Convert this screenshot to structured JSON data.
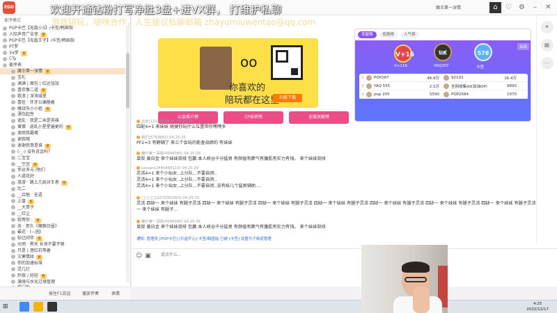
{
  "overlay": {
    "line1": "欢迎开通钻粉打写净胜3盘+进VX群，  打维护私聊",
    "line2": "游戏陪玩，啵咪合作，人生建议私聊邮箱 zhayumiuwentao@qq.com"
  },
  "topbar": {
    "logo_text": "EGO",
    "room_title": "魔王第一深情",
    "owner": "魔王第一深情",
    "window_buttons": [
      "home-icon",
      "heart-icon",
      "gear-icon",
      "minimize-icon",
      "close-icon"
    ]
  },
  "sidebar": {
    "header": "麦序模式",
    "rows": [
      {
        "text": "PGP卡巴【无敌小3】/卡签/韩国指",
        "host": false
      },
      {
        "text": "人际声音广告室",
        "host": false
      },
      {
        "text": "PGP卡巴【无敌王子】/卡签/韩国指",
        "host": false
      },
      {
        "text": "PT罗",
        "host": false
      },
      {
        "text": "3V罗",
        "host": false
      },
      {
        "text": "CTy",
        "host": false
      },
      {
        "text": "麦序表",
        "host": false
      },
      {
        "text": "魔王第一深情",
        "host": true
      },
      {
        "text": "宝礼",
        "host": false
      },
      {
        "text": "满满 | 面包 | 红达加加",
        "host": false
      },
      {
        "text": "喜欢像二道",
        "host": false
      },
      {
        "text": "歌浪 | 深海城里",
        "host": false
      },
      {
        "text": "喜任 · 牙牙公编随着",
        "host": false
      },
      {
        "text": "魔战东小小姐",
        "host": false
      },
      {
        "text": "漂白起性",
        "host": false
      },
      {
        "text": "迷乱 · 我是二米是英雄",
        "host": false
      },
      {
        "text": "黄镀 · 返乱小星星遍更的",
        "host": false
      },
      {
        "text": "谢烦我霸蛋",
        "host": false
      },
      {
        "text": "谢我哦",
        "host": false
      },
      {
        "text": "谢谢我哥是谁",
        "host": false
      },
      {
        "text": "(-_-) 没有说话吗？",
        "host": false
      },
      {
        "text": "二宝宝",
        "host": false
      },
      {
        "text": "__空宜",
        "host": false
      },
      {
        "text": "幸运多元 /他们",
        "host": false
      },
      {
        "text": "人道花好",
        "host": false
      },
      {
        "text": "旅游 · 路上几局对王者",
        "host": false
      },
      {
        "text": "比二",
        "host": false
      },
      {
        "text": "__吕勉 · 无语",
        "host": false
      },
      {
        "text": "上盘",
        "host": false
      },
      {
        "text": "__大哥子",
        "host": false
      },
      {
        "text": "__红尘",
        "host": false
      },
      {
        "text": "我等你 ·",
        "host": false
      },
      {
        "text": "去 · 思久《魔踏日昼》",
        "host": false
      },
      {
        "text": "最近 · (—园)",
        "host": false
      },
      {
        "text": "知己同伴",
        "host": false
      },
      {
        "text": "光明 · 黑天 长须不要不够",
        "host": false
      },
      {
        "text": "只是 | 理红石等着",
        "host": false
      },
      {
        "text": "灾寒情续",
        "host": false
      },
      {
        "text": "你的加速标准",
        "host": false
      },
      {
        "text": "灵几灯",
        "host": false
      },
      {
        "text": "烈夜 / 轻轻",
        "host": false
      },
      {
        "text": "满境与水化过境管理",
        "host": false
      },
      {
        "text": "蜀门你",
        "host": false
      },
      {
        "text": "腰部的格元下等",
        "host": false
      }
    ],
    "tag": "官"
  },
  "banner": {
    "slogan1": "你喜欢的",
    "slogan2": "陪玩都在这里",
    "scan_label": "扫我下载",
    "eyes": "oo"
  },
  "tabs": [
    "公会推介榜",
    "CP亲密榜",
    "全服贡献榜"
  ],
  "rank": {
    "tabs": [
      "贡献榜",
      "抱抱榜",
      "人气榜"
    ],
    "close_label": "关闭",
    "medals": [
      {
        "label": "V+16",
        "sub": "V+116"
      },
      {
        "label": "钻贰",
        "sub": "YAQ207"
      },
      {
        "label": "578",
        "sub": "卡签"
      }
    ],
    "rows": [
      {
        "n": "1",
        "name": "POP287",
        "val": "46.8万",
        "name2": "92102",
        "val2": "16.4万"
      },
      {
        "n": "2",
        "name": "YAQ 555",
        "val": "2.5万",
        "name2": "全网收集dd(加油OP)",
        "val2": "9890"
      },
      {
        "n": "3",
        "name": "pop 205",
        "val": "5590",
        "name2": "POP2584",
        "val2": "1970"
      }
    ]
  },
  "chat": {
    "messages": [
      {
        "meta": "北京(1212482973)  04:25:24",
        "body": "匹配4=1 来妹妹 随便你玩什么位置带你嘿嘿多"
      },
      {
        "meta": "我们(5793682)  04:25:25",
        "body": "PF2=3 有野辅了 来三个会玩的能查战绩的 有妹妹"
      },
      {
        "meta": "魔尔第一深情(4546085)  04:25:28",
        "body": "单双 黄日金 来个妹妹双排 包赢 本人峡谷千分猛男 有颜值有脾气有腹肌有实力有钱。 来个妹妹双排"
      },
      {
        "meta": "Lesuan(2440468110)  04:25:29",
        "body": "灵活4=1 来个小仙女..上分队...不要自闭..\n灵活4=1 来个小仙女..上分队...不要自闭..\n灵活4=1 来个小仙女..上分队...不要自闭..没有妹儿个猛男辅助...."
      },
      {
        "meta": "□□□□(2270002993)  04:25:35",
        "body": "灵活 四缺一 来个妹妹 有腿子灵活 四缺一 来个妹妹 有腿子灵活 四缺一 来个妹妹 有腿子灵活 四缺一 来个妹妹 有腿子灵活 四缺一 来个妹妹 有腿子灵活 四缺一 来个妹妹 有腿子灵活 四缺一 来个妹妹 有腿子灵活 四缺一 来个妹妹 有腿子..."
      },
      {
        "meta": "魔尔第一深情(4546085)  04:25:36",
        "body": "单双 黄日金 来个妹妹双排 包赢 本人峡谷千分猛男 有颜值有脾气有腹肌有实力有钱。 来个妹妹双排"
      }
    ],
    "system": "通知: 管理员 [POP卡巴] [乐益开心] 卡签/韩国指 已被 [卡签] 设置为子频道管理"
  },
  "input": {
    "placeholder": "说点什么..."
  },
  "bottom": {
    "buttons": [
      "按住F1说话",
      "播放伴奏",
      "表情"
    ]
  },
  "taskbar": {
    "time": "4:25",
    "date": "2022/12/17"
  }
}
